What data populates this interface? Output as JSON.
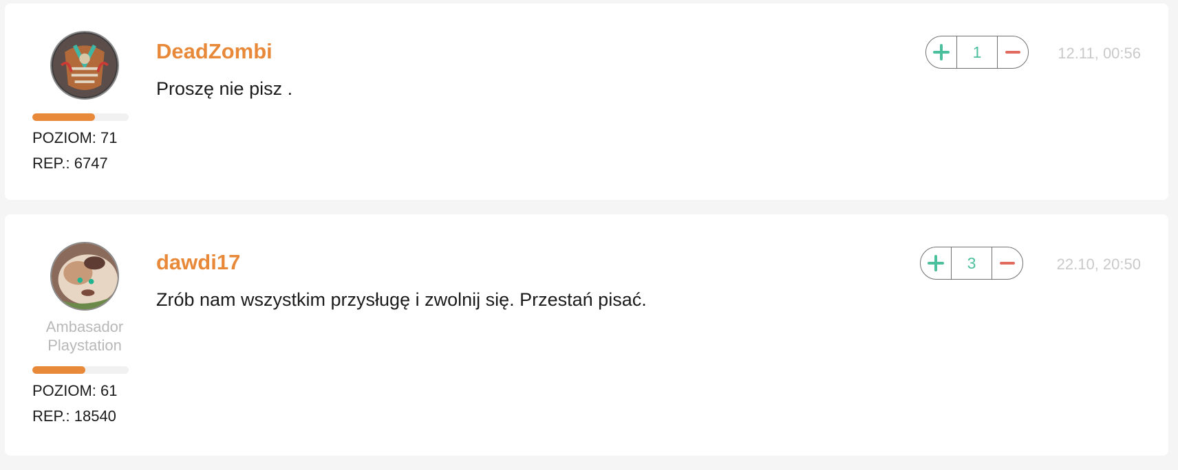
{
  "comments": [
    {
      "username": "DeadZombi",
      "text": "Proszę nie pisz .",
      "rank": "",
      "level_label": "POZIOM: 71",
      "level_fraction": 0.65,
      "rep_label": "REP.: 6747",
      "votes": "1",
      "timestamp": "12.11, 00:56"
    },
    {
      "username": "dawdi17",
      "text": "Zrób nam wszystkim przysługę i zwolnij się. Przestań pisać.",
      "rank": "Ambasador Playstation",
      "level_label": "POZIOM: 61",
      "level_fraction": 0.55,
      "rep_label": "REP.: 18540",
      "votes": "3",
      "timestamp": "22.10, 20:50"
    }
  ],
  "colors": {
    "accent": "#e8893a",
    "upvote": "#4cbf9c",
    "downvote": "#e06a5e",
    "muted": "#c9c9c9"
  },
  "icons": {
    "upvote": "plus-icon",
    "downvote": "minus-icon"
  }
}
